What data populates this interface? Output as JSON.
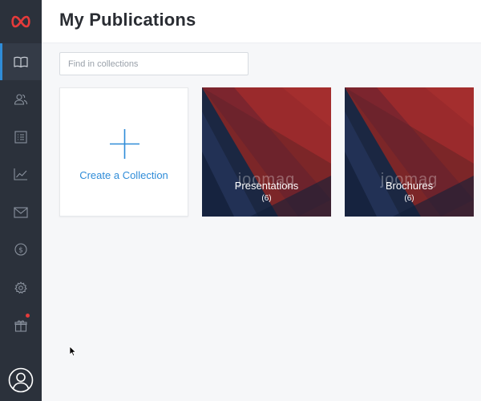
{
  "header": {
    "title": "My Publications"
  },
  "search": {
    "placeholder": "Find in collections"
  },
  "sidebar": {
    "items": [
      {
        "name": "publications",
        "icon": "book-icon"
      },
      {
        "name": "audience",
        "icon": "users-icon"
      },
      {
        "name": "lists",
        "icon": "list-icon"
      },
      {
        "name": "analytics",
        "icon": "chart-icon"
      },
      {
        "name": "email",
        "icon": "envelope-icon"
      },
      {
        "name": "monetization",
        "icon": "dollar-icon"
      },
      {
        "name": "settings",
        "icon": "gear-icon"
      },
      {
        "name": "gifts",
        "icon": "gift-icon"
      }
    ]
  },
  "create_card": {
    "label": "Create a Collection"
  },
  "collections": [
    {
      "name": "Presentations",
      "count": "(6)",
      "watermark": "joomag"
    },
    {
      "name": "Brochures",
      "count": "(6)",
      "watermark": "joomag"
    }
  ],
  "colors": {
    "sidebar_bg": "#2b313b",
    "accent": "#2f8cd8",
    "brand": "#e53b3b",
    "cover_red": "#9a2a2c",
    "cover_navy": "#1b2742"
  }
}
